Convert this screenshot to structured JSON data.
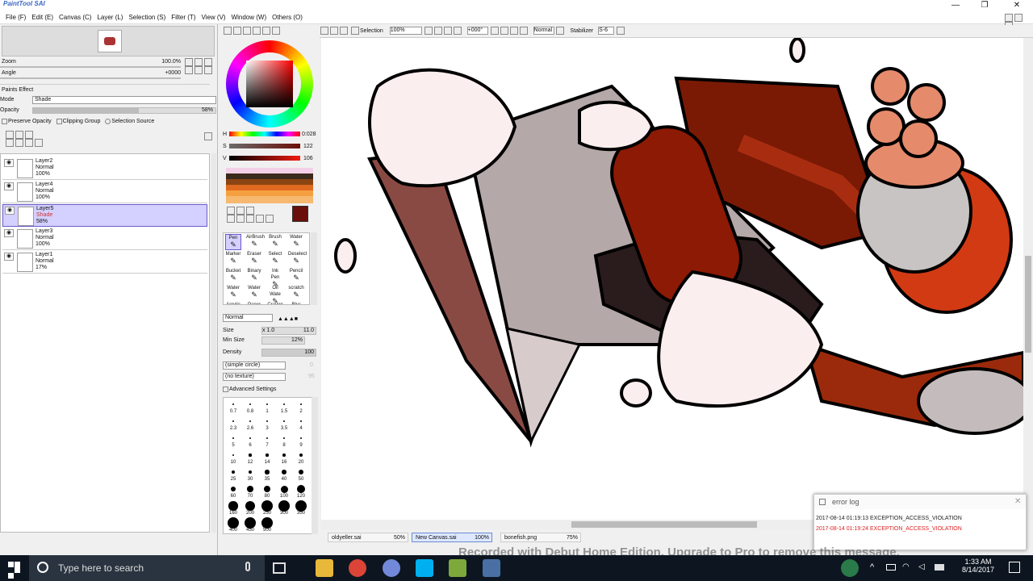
{
  "app": {
    "logo": "PaintTool SAI",
    "minimize": "—",
    "maximize": "❐",
    "close": "✕"
  },
  "menu": [
    "File (F)",
    "Edit (E)",
    "Canvas (C)",
    "Layer (L)",
    "Selection (S)",
    "Filter (T)",
    "View (V)",
    "Window (W)",
    "Others (O)"
  ],
  "navigator": {
    "zoom_label": "Zoom",
    "zoom_value": "100.0%",
    "angle_label": "Angle",
    "angle_value": "+0000"
  },
  "layer_props": {
    "section": "Paints Effect",
    "mode_label": "Mode",
    "mode_value": "Shade",
    "opacity_label": "Opacity",
    "opacity_value": "58%",
    "opacity_fraction": 0.58,
    "preserve_opacity": "Preserve Opacity",
    "clipping_group": "Clipping Group",
    "selection_source": "Selection Source"
  },
  "layers": [
    {
      "name": "Layer2",
      "mode": "Normal",
      "opacity": "100%",
      "selected": false
    },
    {
      "name": "Layer4",
      "mode": "Normal",
      "opacity": "100%",
      "selected": false
    },
    {
      "name": "Layer5",
      "mode": "Shade",
      "opacity": "58%",
      "selected": true
    },
    {
      "name": "Layer3",
      "mode": "Normal",
      "opacity": "100%",
      "selected": false
    },
    {
      "name": "Layer1",
      "mode": "Normal",
      "opacity": "17%",
      "selected": false
    }
  ],
  "color": {
    "current": "#6b0f0a",
    "h_label": "H",
    "h_value": "0:028",
    "s_label": "S",
    "s_value": "122",
    "v_label": "V",
    "v_value": "106"
  },
  "tools": {
    "row1": [
      "Pen",
      "AirBrush",
      "Brush",
      "Water"
    ],
    "row2": [
      "Marker",
      "Eraser",
      "Select",
      "Deselect"
    ],
    "row3": [
      "Bucket",
      "Binary",
      "Ink Pen",
      "Pencil"
    ],
    "row4": [
      "Water",
      "Water",
      "Oil Wate",
      "scratch"
    ],
    "row4_sub": [
      "9",
      "10",
      "",
      ""
    ],
    "row5": [
      "Acrylic",
      "Paper",
      "Crayon",
      "Blur"
    ]
  },
  "brush": {
    "blend": "Normal",
    "size_label": "Size",
    "size_mult": "x 1.0",
    "size_value": "11.0",
    "minsize_label": "Min Size",
    "minsize_value": "12%",
    "density_label": "Density",
    "density_value": "100",
    "shape": "(simple circle)",
    "shape_val": "0",
    "texture": "(no texture)",
    "texture_val": "95",
    "advanced": "Advanced Settings"
  },
  "brush_sizes": [
    "0.7",
    "0.8",
    "1",
    "1.5",
    "2",
    "2.3",
    "2.6",
    "3",
    "3.5",
    "4",
    "5",
    "6",
    "7",
    "8",
    "9",
    "10",
    "12",
    "14",
    "16",
    "20",
    "25",
    "30",
    "35",
    "40",
    "50",
    "60",
    "70",
    "80",
    "100",
    "120",
    "160",
    "200",
    "250",
    "300",
    "350",
    "400",
    "450",
    "500"
  ],
  "canvas_toolbar": {
    "selection": "Selection",
    "zoom": "100%",
    "angle": "+000°",
    "mode": "Normal",
    "stabilizer_label": "Stabilizer",
    "stabilizer_value": "S-6"
  },
  "tabs": [
    {
      "name": "oldyeller.sai",
      "zoom": "50%"
    },
    {
      "name": "New Canvas.sai",
      "zoom": "100%"
    },
    {
      "name": "bonefish.png",
      "zoom": "75%"
    }
  ],
  "error_log": {
    "title": "error log",
    "lines": [
      "2017-08-14 01:19:13 EXCEPTION_ACCESS_VIOLATION",
      "2017-08-14 01:19:24 EXCEPTION_ACCESS_VIOLATION"
    ]
  },
  "watermark": "Recorded with Debut Home Edition. Upgrade to Pro to remove this message.",
  "taskbar": {
    "search": "Type here to search",
    "time": "1:33 AM",
    "date": "8/14/2017"
  }
}
